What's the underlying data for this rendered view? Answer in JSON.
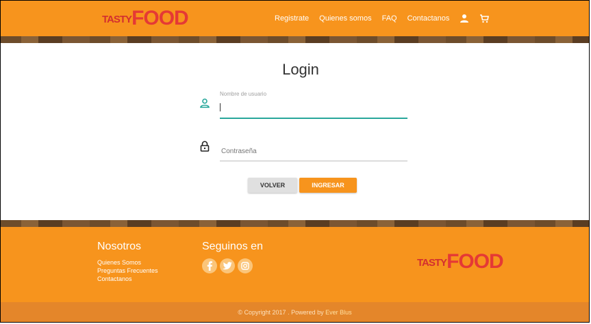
{
  "header": {
    "logo_small": "TASTY",
    "logo_big": "FOOD",
    "nav": [
      "Registrate",
      "Quienes somos",
      "FAQ",
      "Contactanos"
    ],
    "icons": [
      "user-icon",
      "cart-icon"
    ]
  },
  "login": {
    "title": "Login",
    "username_label": "Nombre de usuario",
    "username_value": "",
    "password_placeholder": "Contraseña",
    "back_label": "VOLVER",
    "submit_label": "INGRESAR"
  },
  "footer": {
    "about_heading": "Nosotros",
    "about_links": [
      "Quienes Somos",
      "Preguntas Frecuentes",
      "Contactanos"
    ],
    "follow_heading": "Seguinos en",
    "social_icons": [
      "facebook-icon",
      "twitter-icon",
      "instagram-icon"
    ],
    "logo_small": "TASTY",
    "logo_big": "FOOD",
    "copyright_prefix": "© Copyright 2017 . Powered by ",
    "copyright_author": "Ever Blus"
  },
  "colors": {
    "primary": "#f7941d",
    "accent": "#26a69a",
    "logo_red": "#e53935"
  }
}
